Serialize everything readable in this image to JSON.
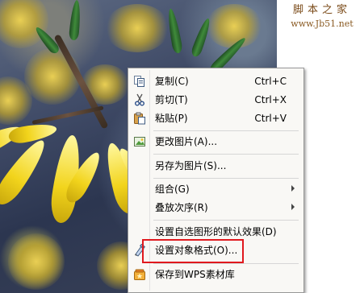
{
  "watermark": {
    "site_cn": "脚本之家",
    "site_url": "www.Jb51.net"
  },
  "context_menu": {
    "items": [
      {
        "label": "复制(C)",
        "shortcut": "Ctrl+C",
        "icon": "copy-icon"
      },
      {
        "label": "剪切(T)",
        "shortcut": "Ctrl+X",
        "icon": "scissors-icon"
      },
      {
        "label": "粘贴(P)",
        "shortcut": "Ctrl+V",
        "icon": "paste-icon"
      },
      {
        "label": "更改图片(A)...",
        "icon": "change-picture-icon"
      },
      {
        "label": "另存为图片(S)..."
      },
      {
        "label": "组合(G)",
        "submenu": true
      },
      {
        "label": "叠放次序(R)",
        "submenu": true
      },
      {
        "label": "设置自选图形的默认效果(D)"
      },
      {
        "label": "设置对象格式(O)...",
        "icon": "format-object-icon",
        "highlighted": true,
        "highlight_color": "#e0191e"
      },
      {
        "label": "保存到WPS素材库",
        "icon": "wps-library-icon"
      }
    ]
  }
}
